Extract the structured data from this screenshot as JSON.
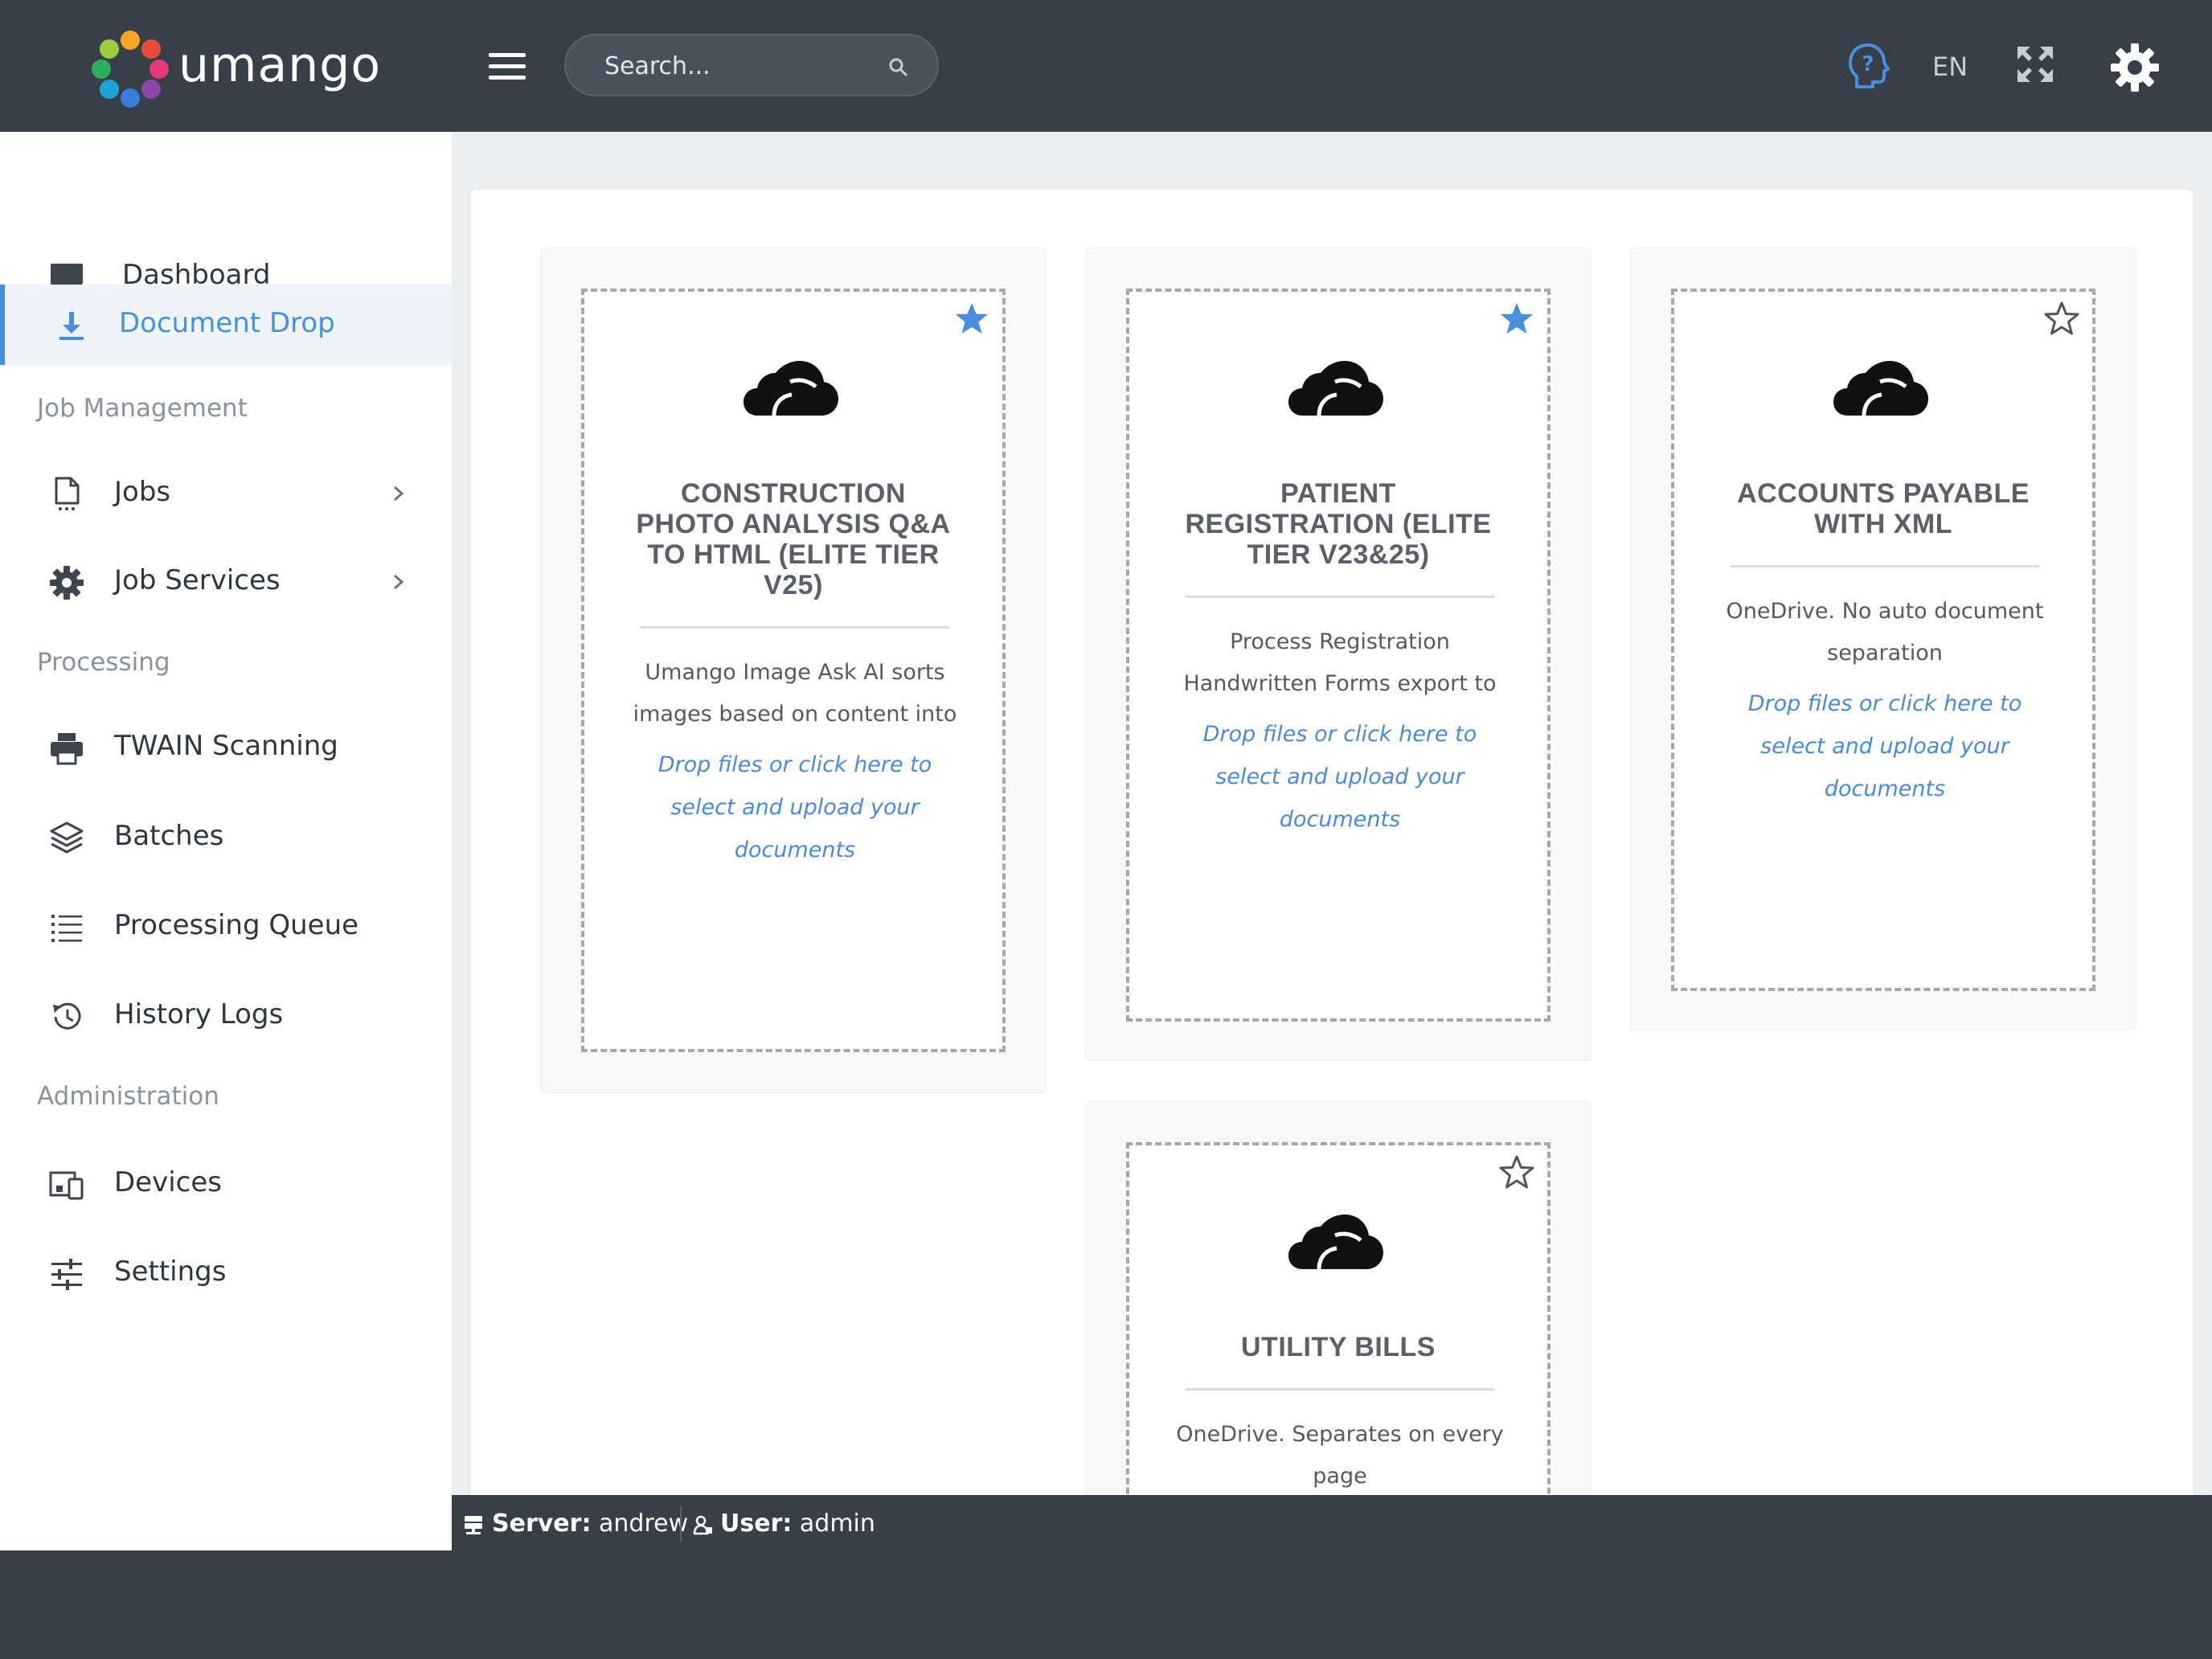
{
  "header": {
    "logo_text": "umango",
    "search_placeholder": "Search...",
    "language": "EN"
  },
  "sidebar": {
    "items": [
      {
        "label": "Dashboard"
      },
      {
        "label": "Document Drop"
      },
      {
        "label": "Jobs"
      },
      {
        "label": "Job Services"
      },
      {
        "label": "TWAIN Scanning"
      },
      {
        "label": "Batches"
      },
      {
        "label": "Processing Queue"
      },
      {
        "label": "History Logs"
      },
      {
        "label": "Devices"
      },
      {
        "label": "Settings"
      }
    ],
    "sections": {
      "job_management": "Job Management",
      "processing": "Processing",
      "administration": "Administration"
    }
  },
  "cards": [
    {
      "title": "CONSTRUCTION PHOTO ANALYSIS Q&A TO HTML (ELITE TIER V25)",
      "description": "Umango Image Ask AI sorts images based on content into",
      "link": "Drop files or click here to select and upload your documents",
      "favorite": true
    },
    {
      "title": "PATIENT REGISTRATION (ELITE TIER V23&25)",
      "description": "Process Registration Handwritten Forms export to",
      "link": "Drop files or click here to select and upload your documents",
      "favorite": true
    },
    {
      "title": "ACCOUNTS PAYABLE WITH XML",
      "description": "OneDrive. No auto document separation",
      "link": "Drop files or click here to select and upload your documents",
      "favorite": false
    },
    {
      "title": "UTILITY BILLS",
      "description": "OneDrive. Separates on every page",
      "favorite": false
    }
  ],
  "status": {
    "server_label": "Server:",
    "server_value": "andrew",
    "user_label": "User:",
    "user_value": "admin"
  },
  "colors": {
    "topbar": "#373f49",
    "accent": "#4c8fd9",
    "star_active": "#4c8fd9"
  }
}
